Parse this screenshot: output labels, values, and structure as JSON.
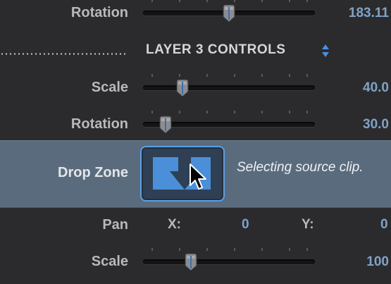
{
  "rows": {
    "rotation_top": {
      "label": "Rotation",
      "value": "183.11",
      "level": 0.5
    },
    "section": {
      "title": "LAYER 3 CONTROLS",
      "arrows_icon": "up-down-arrows-icon"
    },
    "scale_1": {
      "label": "Scale",
      "value": "40.0",
      "level": 0.23
    },
    "rotation_2": {
      "label": "Rotation",
      "value": "30.0",
      "level": 0.13
    },
    "drop_zone": {
      "label": "Drop Zone",
      "status": "Selecting source clip.",
      "icon": "drop-arrow-icon",
      "cursor": "pointer-cursor-icon"
    },
    "pan": {
      "label": "Pan",
      "x_label": "X:",
      "x_value": "0",
      "y_label": "Y:",
      "y_value": "0"
    },
    "scale_2": {
      "label": "Scale",
      "value": "100",
      "level": 0.28
    }
  },
  "colors": {
    "background": "#2b2b2d",
    "value_text": "#7fa3c7",
    "drop_zone_bg": "#5a6b7d",
    "accent": "#5aa0e6"
  }
}
